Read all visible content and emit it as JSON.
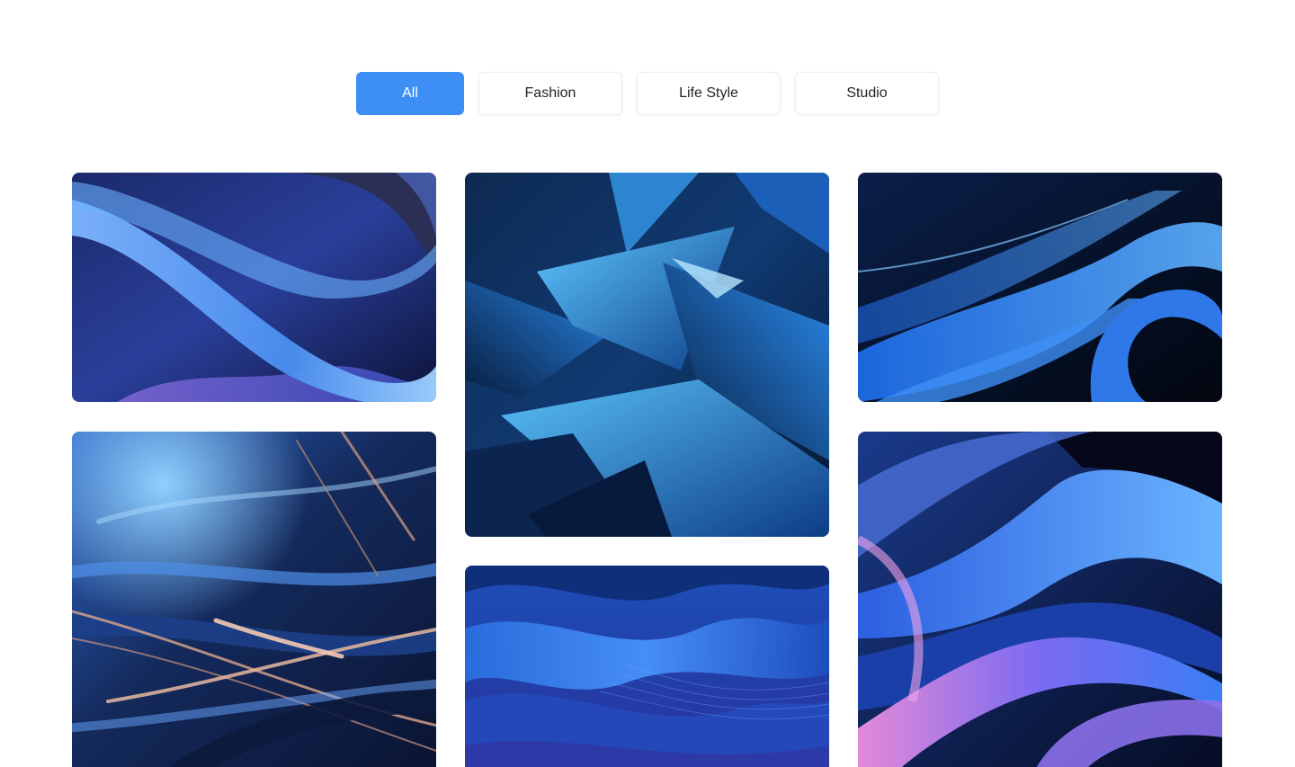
{
  "filters": {
    "tabs": [
      {
        "label": "All",
        "active": true
      },
      {
        "label": "Fashion",
        "active": false
      },
      {
        "label": "Life Style",
        "active": false
      },
      {
        "label": "Studio",
        "active": false
      }
    ],
    "active_color": "#3d8ef5"
  },
  "gallery": {
    "images": [
      {
        "icon": "abstract-blue-purple-waves-image"
      },
      {
        "icon": "abstract-blue-copper-streaks-image"
      },
      {
        "icon": "abstract-blue-glass-shards-image"
      },
      {
        "icon": "abstract-blue-fabric-dunes-image"
      },
      {
        "icon": "abstract-blue-neon-curves-image"
      },
      {
        "icon": "abstract-blue-pink-ribbons-image"
      }
    ]
  }
}
